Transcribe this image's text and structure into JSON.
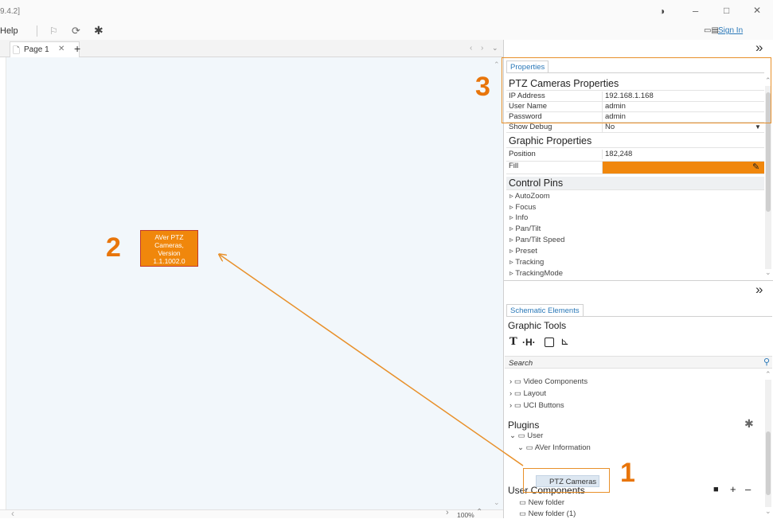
{
  "window": {
    "title_fragment": "9.4.2]",
    "contrast_icon": "◑",
    "minimize": "–",
    "maximize": "□",
    "close": "✕"
  },
  "menu": {
    "help": "Help",
    "sign_in": "Sign In"
  },
  "page_tab": {
    "label": "Page 1",
    "close": "✕",
    "add": "+"
  },
  "canvas": {
    "component_lines": [
      "AVer PTZ",
      "Cameras,",
      "Version",
      "1.1.1002.0"
    ],
    "zoom": "100%"
  },
  "properties": {
    "tab_label": "Properties",
    "section_title": "PTZ Cameras Properties",
    "rows": [
      {
        "key": "IP Address",
        "value": "192.168.1.168"
      },
      {
        "key": "User Name",
        "value": "admin"
      },
      {
        "key": "Password",
        "value": "admin"
      },
      {
        "key": "Show Debug",
        "value": "No"
      }
    ],
    "graphic_title": "Graphic Properties",
    "graphic_rows": [
      {
        "key": "Position",
        "value": "182,248"
      },
      {
        "key": "Fill",
        "value": ""
      }
    ],
    "fill_color": "#f0870c",
    "control_pins_title": "Control Pins",
    "pins": [
      "AutoZoom",
      "Focus",
      "Info",
      "Pan/Tilt",
      "Pan/Tilt Speed",
      "Preset",
      "Tracking",
      "TrackingMode"
    ]
  },
  "schematic": {
    "tab_label": "Schematic Elements",
    "graphic_tools_title": "Graphic Tools",
    "search_placeholder": "Search",
    "folders": [
      "Video Components",
      "Layout",
      "UCI Buttons"
    ],
    "plugins_title": "Plugins",
    "plugin_user": "User",
    "plugin_aver": "AVer Information",
    "plugin_item": "PTZ Cameras",
    "user_components_title": "User Components",
    "user_folders": [
      "New folder",
      "New folder (1)"
    ]
  },
  "callouts": {
    "one": "1",
    "two": "2",
    "three": "3"
  },
  "colors": {
    "accent_orange": "#e8750a",
    "link_blue": "#2a78b8"
  }
}
